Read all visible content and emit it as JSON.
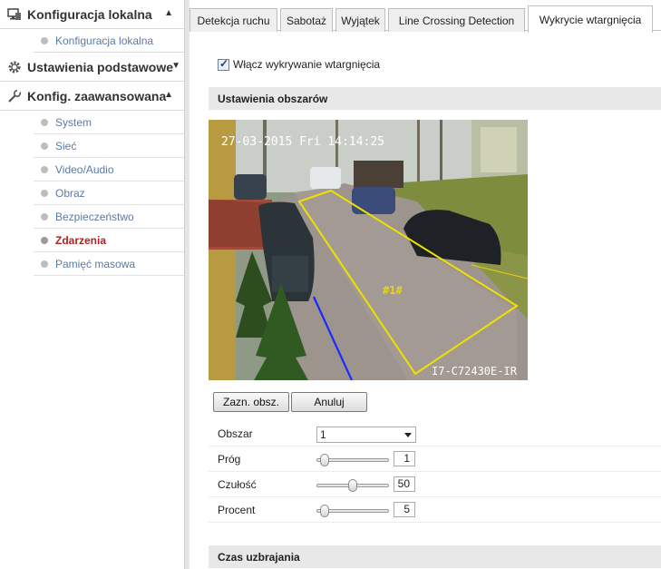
{
  "sidebar": {
    "local": {
      "title": "Konfiguracja lokalna",
      "items": [
        {
          "label": "Konfiguracja lokalna"
        }
      ]
    },
    "basic": {
      "title": "Ustawienia podstawowe"
    },
    "advanced": {
      "title": "Konfig. zaawansowana",
      "items": [
        {
          "label": "System"
        },
        {
          "label": "Sieć"
        },
        {
          "label": "Video/Audio"
        },
        {
          "label": "Obraz"
        },
        {
          "label": "Bezpieczeństwo"
        },
        {
          "label": "Zdarzenia"
        },
        {
          "label": "Pamięć masowa"
        }
      ],
      "active": "Zdarzenia"
    }
  },
  "tabs": [
    {
      "label": "Detekcja ruchu"
    },
    {
      "label": "Sabotaż"
    },
    {
      "label": "Wyjątek"
    },
    {
      "label": "Line Crossing Detection"
    },
    {
      "label": "Wykrycie wtargnięcia"
    }
  ],
  "active_tab": "Wykrycie wtargnięcia",
  "enable_checkbox": {
    "label": "Włącz wykrywanie wtargnięcia",
    "checked": true
  },
  "area_settings": {
    "title": "Ustawienia obszarów",
    "video": {
      "timestamp": "27-03-2015 Fri 14:14:25",
      "region_label": "#1#",
      "camera_model": "I7-C72430E-IR"
    },
    "draw_button": "Zazn. obsz.",
    "cancel_button": "Anuluj",
    "fields": {
      "area": {
        "label": "Obszar",
        "value": "1"
      },
      "threshold": {
        "label": "Próg",
        "value": "1",
        "level": 0.05
      },
      "sensitivity": {
        "label": "Czułość",
        "value": "50",
        "level": 0.5
      },
      "percent": {
        "label": "Procent",
        "value": "5",
        "level": 0.05
      }
    }
  },
  "arming": {
    "title": "Czas uzbrajania"
  },
  "colors": {
    "region_outline": "#f0e000",
    "line_crossing": "#1a2aff",
    "osd_text": "#ffffff",
    "active_nav": "#b32020",
    "nav_link": "#5a7aa6"
  }
}
